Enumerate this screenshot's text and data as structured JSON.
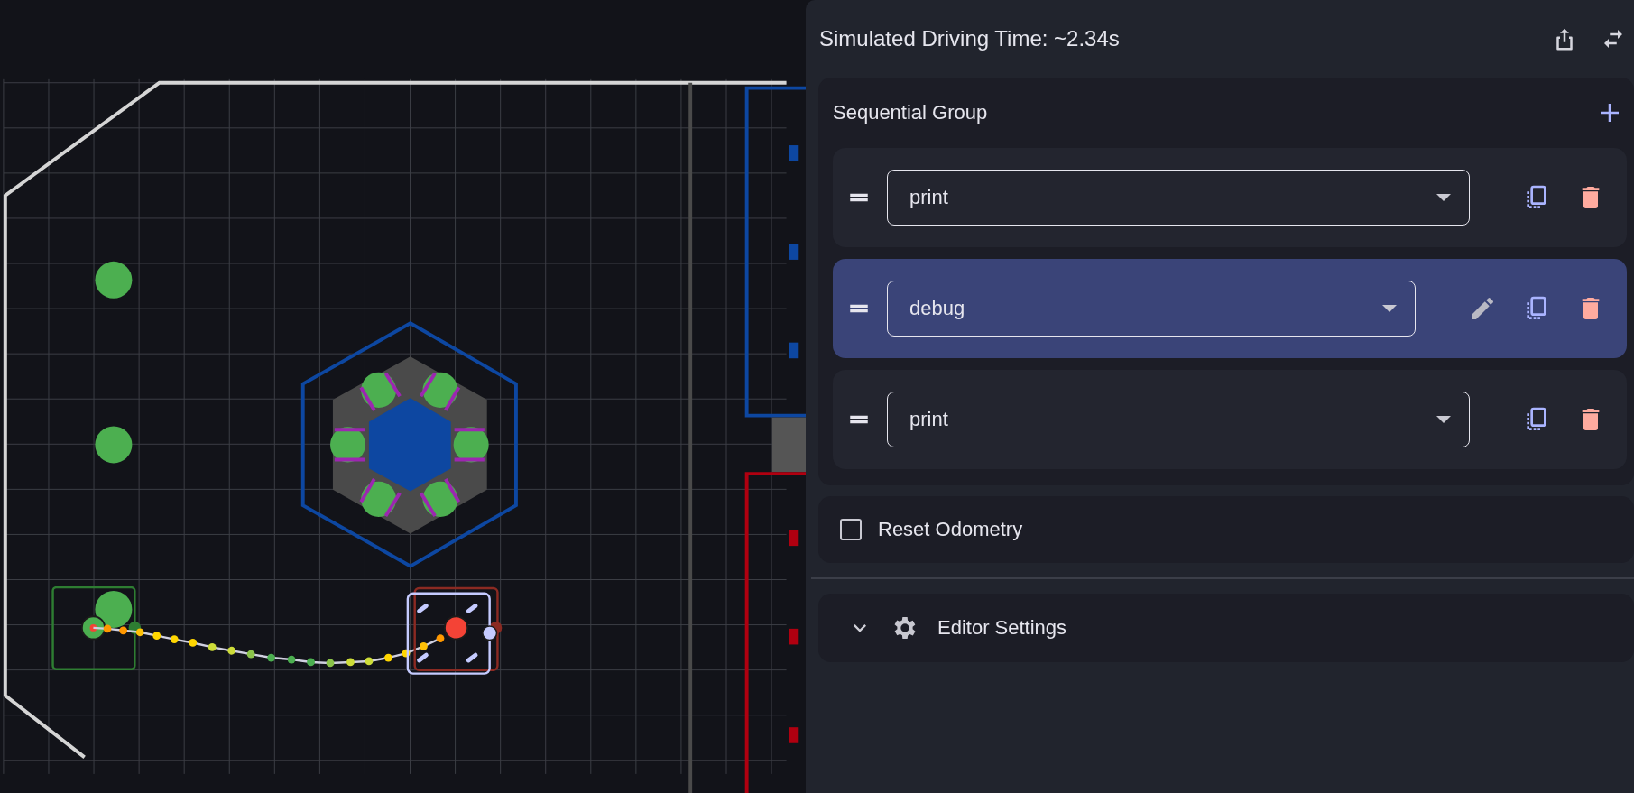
{
  "panel": {
    "title": "Simulated Driving Time: ~2.34s"
  },
  "group": {
    "title": "Sequential Group",
    "commands": [
      {
        "value": "print",
        "selected": false
      },
      {
        "value": "debug",
        "selected": true
      },
      {
        "value": "print",
        "selected": false
      }
    ]
  },
  "reset_odometry": {
    "label": "Reset Odometry",
    "checked": false
  },
  "editor_settings": {
    "label": "Editor Settings",
    "expanded": false
  }
}
